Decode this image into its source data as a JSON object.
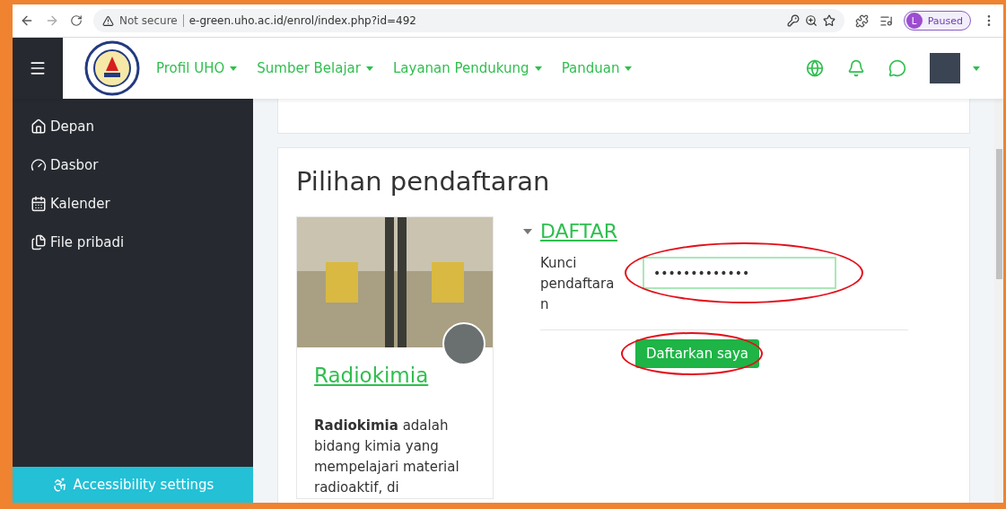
{
  "browser": {
    "security_label": "Not secure",
    "url": "e-green.uho.ac.id/enrol/index.php?id=492",
    "profile": {
      "initial": "L",
      "status": "Paused"
    }
  },
  "navbar": {
    "menu_items": [
      {
        "label": "Profil UHO"
      },
      {
        "label": "Sumber Belajar"
      },
      {
        "label": "Layanan Pendukung"
      },
      {
        "label": "Panduan"
      }
    ]
  },
  "sidebar": {
    "items": [
      {
        "label": "Depan"
      },
      {
        "label": "Dasbor"
      },
      {
        "label": "Kalender"
      },
      {
        "label": "File pribadi"
      }
    ],
    "footer": "Accessibility settings"
  },
  "page": {
    "title": "Pilihan pendaftaran",
    "course": {
      "name": "Radiokimia",
      "summary": "**Radiokimia** adalah bidang kimia yang mempelajari material radioaktif, di"
    },
    "enrol": {
      "heading": "DAFTAR",
      "expanded": true,
      "field_label": "Kunci pendaftaran",
      "value": "•••••••••••••",
      "highlighted": true,
      "button": {
        "label": "Daftarkan saya",
        "highlighted": true
      }
    }
  }
}
